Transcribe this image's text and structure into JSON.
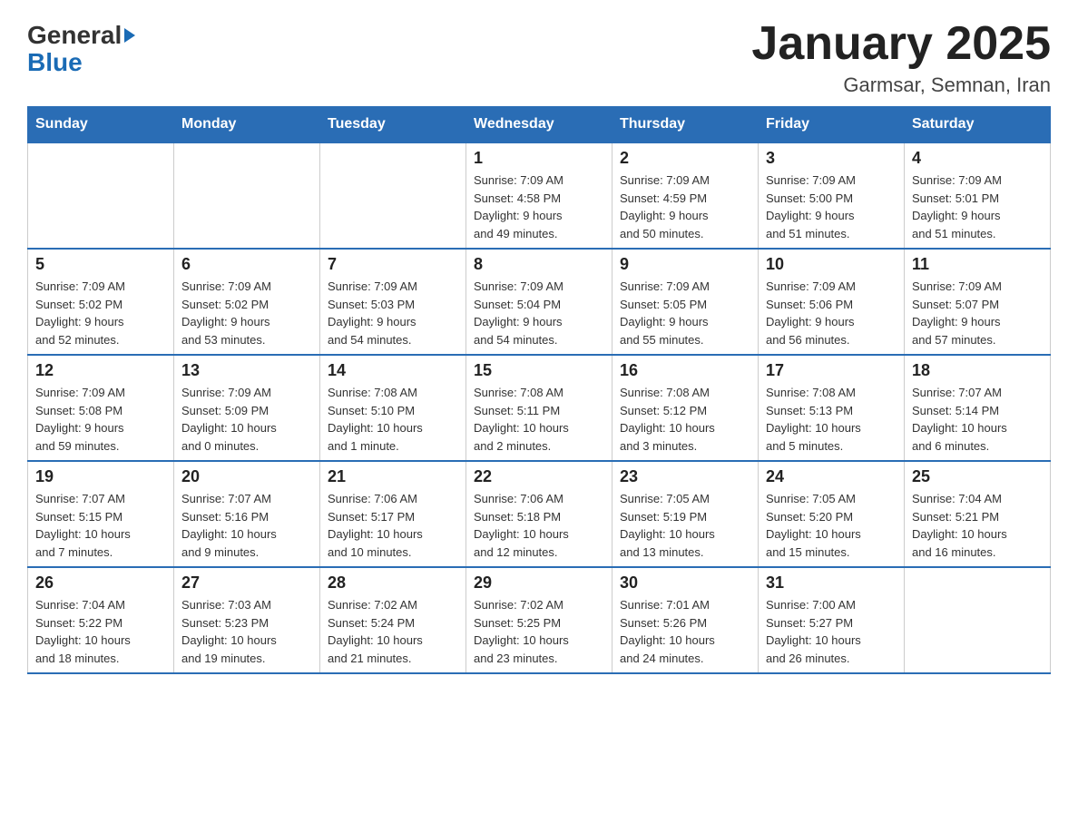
{
  "header": {
    "logo": {
      "general": "General",
      "triangle": "▶",
      "blue": "Blue"
    },
    "title": "January 2025",
    "subtitle": "Garmsar, Semnan, Iran"
  },
  "weekdays": [
    "Sunday",
    "Monday",
    "Tuesday",
    "Wednesday",
    "Thursday",
    "Friday",
    "Saturday"
  ],
  "weeks": [
    [
      {
        "day": "",
        "info": ""
      },
      {
        "day": "",
        "info": ""
      },
      {
        "day": "",
        "info": ""
      },
      {
        "day": "1",
        "info": "Sunrise: 7:09 AM\nSunset: 4:58 PM\nDaylight: 9 hours\nand 49 minutes."
      },
      {
        "day": "2",
        "info": "Sunrise: 7:09 AM\nSunset: 4:59 PM\nDaylight: 9 hours\nand 50 minutes."
      },
      {
        "day": "3",
        "info": "Sunrise: 7:09 AM\nSunset: 5:00 PM\nDaylight: 9 hours\nand 51 minutes."
      },
      {
        "day": "4",
        "info": "Sunrise: 7:09 AM\nSunset: 5:01 PM\nDaylight: 9 hours\nand 51 minutes."
      }
    ],
    [
      {
        "day": "5",
        "info": "Sunrise: 7:09 AM\nSunset: 5:02 PM\nDaylight: 9 hours\nand 52 minutes."
      },
      {
        "day": "6",
        "info": "Sunrise: 7:09 AM\nSunset: 5:02 PM\nDaylight: 9 hours\nand 53 minutes."
      },
      {
        "day": "7",
        "info": "Sunrise: 7:09 AM\nSunset: 5:03 PM\nDaylight: 9 hours\nand 54 minutes."
      },
      {
        "day": "8",
        "info": "Sunrise: 7:09 AM\nSunset: 5:04 PM\nDaylight: 9 hours\nand 54 minutes."
      },
      {
        "day": "9",
        "info": "Sunrise: 7:09 AM\nSunset: 5:05 PM\nDaylight: 9 hours\nand 55 minutes."
      },
      {
        "day": "10",
        "info": "Sunrise: 7:09 AM\nSunset: 5:06 PM\nDaylight: 9 hours\nand 56 minutes."
      },
      {
        "day": "11",
        "info": "Sunrise: 7:09 AM\nSunset: 5:07 PM\nDaylight: 9 hours\nand 57 minutes."
      }
    ],
    [
      {
        "day": "12",
        "info": "Sunrise: 7:09 AM\nSunset: 5:08 PM\nDaylight: 9 hours\nand 59 minutes."
      },
      {
        "day": "13",
        "info": "Sunrise: 7:09 AM\nSunset: 5:09 PM\nDaylight: 10 hours\nand 0 minutes."
      },
      {
        "day": "14",
        "info": "Sunrise: 7:08 AM\nSunset: 5:10 PM\nDaylight: 10 hours\nand 1 minute."
      },
      {
        "day": "15",
        "info": "Sunrise: 7:08 AM\nSunset: 5:11 PM\nDaylight: 10 hours\nand 2 minutes."
      },
      {
        "day": "16",
        "info": "Sunrise: 7:08 AM\nSunset: 5:12 PM\nDaylight: 10 hours\nand 3 minutes."
      },
      {
        "day": "17",
        "info": "Sunrise: 7:08 AM\nSunset: 5:13 PM\nDaylight: 10 hours\nand 5 minutes."
      },
      {
        "day": "18",
        "info": "Sunrise: 7:07 AM\nSunset: 5:14 PM\nDaylight: 10 hours\nand 6 minutes."
      }
    ],
    [
      {
        "day": "19",
        "info": "Sunrise: 7:07 AM\nSunset: 5:15 PM\nDaylight: 10 hours\nand 7 minutes."
      },
      {
        "day": "20",
        "info": "Sunrise: 7:07 AM\nSunset: 5:16 PM\nDaylight: 10 hours\nand 9 minutes."
      },
      {
        "day": "21",
        "info": "Sunrise: 7:06 AM\nSunset: 5:17 PM\nDaylight: 10 hours\nand 10 minutes."
      },
      {
        "day": "22",
        "info": "Sunrise: 7:06 AM\nSunset: 5:18 PM\nDaylight: 10 hours\nand 12 minutes."
      },
      {
        "day": "23",
        "info": "Sunrise: 7:05 AM\nSunset: 5:19 PM\nDaylight: 10 hours\nand 13 minutes."
      },
      {
        "day": "24",
        "info": "Sunrise: 7:05 AM\nSunset: 5:20 PM\nDaylight: 10 hours\nand 15 minutes."
      },
      {
        "day": "25",
        "info": "Sunrise: 7:04 AM\nSunset: 5:21 PM\nDaylight: 10 hours\nand 16 minutes."
      }
    ],
    [
      {
        "day": "26",
        "info": "Sunrise: 7:04 AM\nSunset: 5:22 PM\nDaylight: 10 hours\nand 18 minutes."
      },
      {
        "day": "27",
        "info": "Sunrise: 7:03 AM\nSunset: 5:23 PM\nDaylight: 10 hours\nand 19 minutes."
      },
      {
        "day": "28",
        "info": "Sunrise: 7:02 AM\nSunset: 5:24 PM\nDaylight: 10 hours\nand 21 minutes."
      },
      {
        "day": "29",
        "info": "Sunrise: 7:02 AM\nSunset: 5:25 PM\nDaylight: 10 hours\nand 23 minutes."
      },
      {
        "day": "30",
        "info": "Sunrise: 7:01 AM\nSunset: 5:26 PM\nDaylight: 10 hours\nand 24 minutes."
      },
      {
        "day": "31",
        "info": "Sunrise: 7:00 AM\nSunset: 5:27 PM\nDaylight: 10 hours\nand 26 minutes."
      },
      {
        "day": "",
        "info": ""
      }
    ]
  ]
}
